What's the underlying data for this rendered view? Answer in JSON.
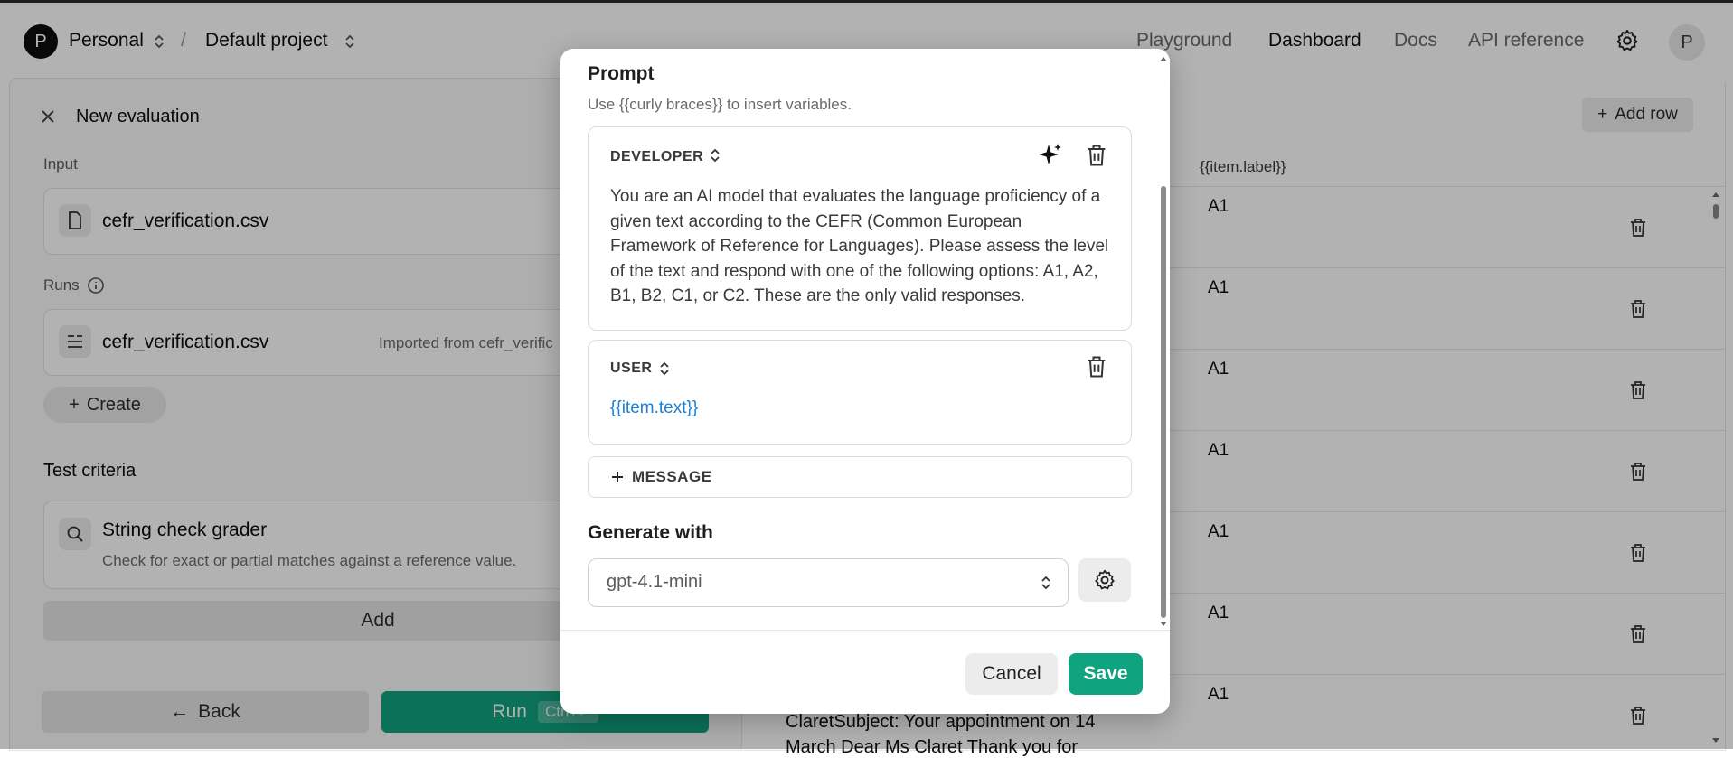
{
  "nav": {
    "org_initial": "P",
    "org_name": "Personal",
    "separator": "/",
    "project_name": "Default project",
    "links": [
      "Playground",
      "Dashboard",
      "Docs",
      "API reference"
    ],
    "active_link": "Dashboard",
    "user_initial": "P"
  },
  "left": {
    "title": "New evaluation",
    "input_label": "Input",
    "input_file": "cefr_verification.csv",
    "runs_label": "Runs",
    "run_file": "cefr_verification.csv",
    "run_note": "Imported from cefr_verific",
    "create_label": "Create",
    "criteria_title": "Test criteria",
    "grader_name": "String check grader",
    "grader_desc": "Check for exact or partial matches against a reference value.",
    "add_label": "Add",
    "back_label": "Back",
    "run_label": "Run",
    "run_shortcut": "Ctrl+↵"
  },
  "right": {
    "add_row_label": "Add row",
    "column_label": "{{item.label}}",
    "rows": [
      "A1",
      "A1",
      "A1",
      "A1",
      "A1",
      "A1",
      "A1"
    ],
    "partial_text_line1": "ClaretSubject: Your appointment on 14",
    "partial_text_line2": "March Dear Ms Claret Thank you for"
  },
  "modal": {
    "title": "Prompt",
    "subtitle": "Use {{curly braces}} to insert variables.",
    "developer_role": "DEVELOPER",
    "developer_text_lines": [
      "You are an AI model that evaluates the language proficiency of a",
      "given text according to the CEFR (Common European",
      "Framework of Reference for Languages). Please assess the level",
      "of the text and respond with one of the following options: A1, A2,",
      "B1, B2, C1, or C2. These are the only valid responses."
    ],
    "user_role": "USER",
    "user_text": "{{item.text}}",
    "add_message_label": "MESSAGE",
    "generate_title": "Generate with",
    "model_value": "gpt-4.1-mini",
    "cancel_label": "Cancel",
    "save_label": "Save"
  },
  "colors": {
    "accent_green": "#10a37f",
    "variable_blue": "#1a7fd6"
  }
}
